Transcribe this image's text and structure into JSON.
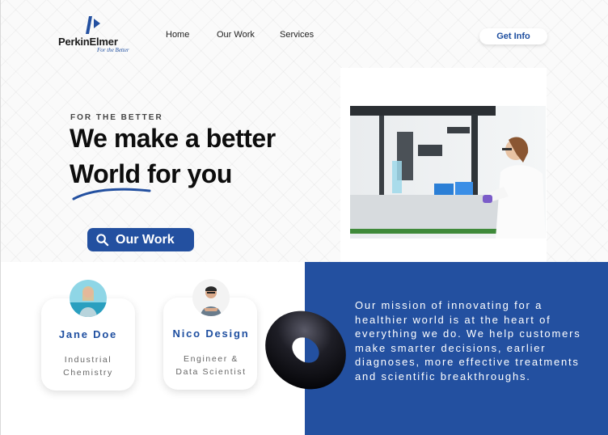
{
  "brand": {
    "name": "PerkinElmer",
    "tagline": "For the Better",
    "color": "#2350a0"
  },
  "nav": {
    "items": [
      "Home",
      "Our Work",
      "Services"
    ],
    "cta_label": "Get Info"
  },
  "hero": {
    "eyebrow": "FOR THE BETTER",
    "headline_line1": "We make a better",
    "headline_line2": "World for you",
    "button_label": "Our Work",
    "button_icon": "search-icon"
  },
  "team": [
    {
      "name": "Jane Doe",
      "role_line1": "Industrial",
      "role_line2": "Chemistry"
    },
    {
      "name": "Nico Design",
      "role_line1": "Engineer &",
      "role_line2": "Data Scientist"
    }
  ],
  "mission": {
    "text": "Our mission of innovating for a healthier world is at the heart of everything we do. We help customers make smarter decisions, earlier diagnoses, more effective treatments and scientific breakthroughs."
  }
}
